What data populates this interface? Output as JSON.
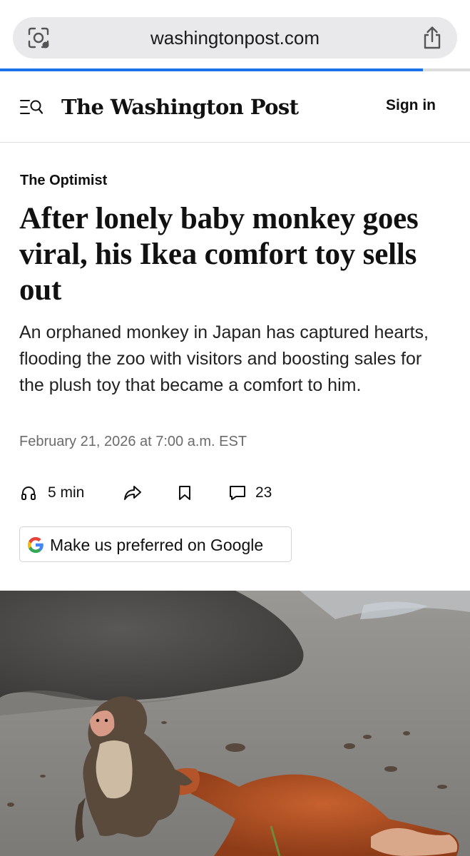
{
  "browser": {
    "url": "washingtonpost.com",
    "load_progress": 0.9,
    "left_icon": "page-settings-icon",
    "right_icon": "share-icon"
  },
  "header": {
    "menu_icon": "menu-search-icon",
    "masthead": "The Washington Post",
    "sign_in": "Sign in"
  },
  "article": {
    "kicker": "The Optimist",
    "headline": "After lonely baby monkey goes viral, his Ikea comfort toy sells out",
    "dek": "An orphaned monkey in Japan has captured hearts, flooding the zoo with visitors and boosting sales for the plush toy that became a comfort to him.",
    "dateline": "February 21, 2026 at 7:00 a.m. EST",
    "actions": {
      "listen_label": "5 min",
      "listen_icon": "headphones-icon",
      "share_icon": "share-arrow-icon",
      "save_icon": "bookmark-icon",
      "comments_icon": "comment-icon",
      "comments_count": "23"
    },
    "google_button": "Make us preferred on Google"
  },
  "photo": {
    "subject": "baby-monkey-with-plush-toy-photo"
  },
  "colors": {
    "progress": "#1a73e8",
    "pill_bg": "#e9e9ec",
    "text": "#111111",
    "muted": "#6b6b6b"
  }
}
